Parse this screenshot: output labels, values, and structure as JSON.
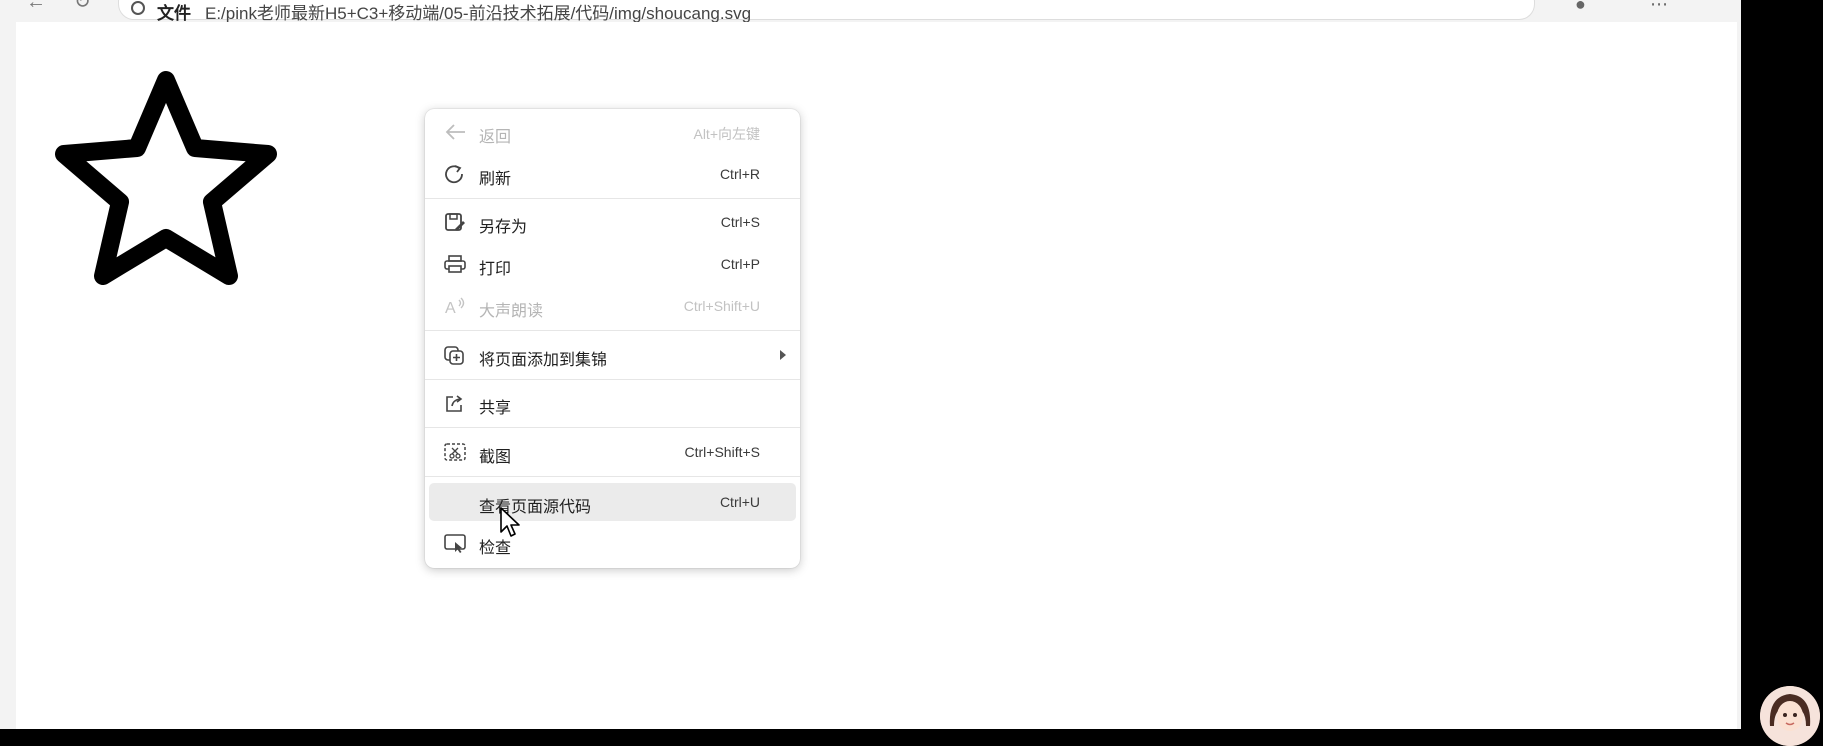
{
  "address_bar": {
    "label": "文件",
    "url": "E:/pink老师最新H5+C3+移动端/05-前沿技术拓展/代码/img/shoucang.svg"
  },
  "context_menu": {
    "items": [
      {
        "label": "返回",
        "shortcut": "Alt+向左键",
        "icon": "back-arrow-icon",
        "disabled": true
      },
      {
        "label": "刷新",
        "shortcut": "Ctrl+R",
        "icon": "refresh-icon",
        "disabled": false
      },
      {
        "label": "另存为",
        "shortcut": "Ctrl+S",
        "icon": "save-as-icon",
        "disabled": false
      },
      {
        "label": "打印",
        "shortcut": "Ctrl+P",
        "icon": "print-icon",
        "disabled": false
      },
      {
        "label": "大声朗读",
        "shortcut": "Ctrl+Shift+U",
        "icon": "read-aloud-icon",
        "disabled": true
      },
      {
        "label": "将页面添加到集锦",
        "shortcut": "",
        "icon": "collections-icon",
        "disabled": false,
        "submenu": true
      },
      {
        "label": "共享",
        "shortcut": "",
        "icon": "share-icon",
        "disabled": false
      },
      {
        "label": "截图",
        "shortcut": "Ctrl+Shift+S",
        "icon": "screenshot-icon",
        "disabled": false
      },
      {
        "label": "查看页面源代码",
        "shortcut": "Ctrl+U",
        "icon": "",
        "disabled": false,
        "highlighted": true
      },
      {
        "label": "检查",
        "shortcut": "",
        "icon": "inspect-icon",
        "disabled": false
      }
    ]
  },
  "colors": {
    "menu_bg": "#ffffff",
    "hover_bg": "#ebebeb",
    "disabled_text": "#b5b5b5",
    "star_stroke": "#000000"
  }
}
